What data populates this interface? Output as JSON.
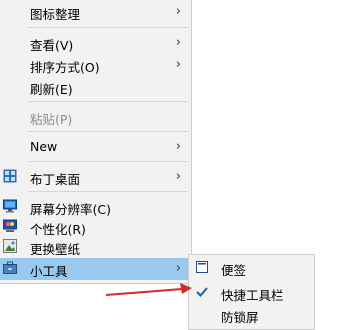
{
  "menu": {
    "items": [
      {
        "label": "图标整理",
        "has_submenu": true
      },
      {
        "label": "查看(V)",
        "has_submenu": true
      },
      {
        "label": "排序方式(O)",
        "has_submenu": true
      },
      {
        "label": "刷新(E)",
        "has_submenu": false
      },
      {
        "label": "粘贴(P)",
        "has_submenu": false,
        "disabled": true
      },
      {
        "label": "New",
        "has_submenu": true
      },
      {
        "label": "布丁桌面",
        "icon": "grid-app-icon",
        "has_submenu": true
      },
      {
        "label": "屏幕分辨率(C)",
        "icon": "monitor-icon",
        "has_submenu": false
      },
      {
        "label": "个性化(R)",
        "icon": "personalize-icon",
        "has_submenu": false
      },
      {
        "label": "更换壁纸",
        "icon": "wallpaper-icon",
        "has_submenu": false
      },
      {
        "label": "小工具",
        "icon": "toolbox-icon",
        "has_submenu": true,
        "highlighted": true
      }
    ],
    "arrow_glyph": "›"
  },
  "submenu": {
    "items": [
      {
        "label": "便签",
        "icon": "note-icon"
      },
      {
        "label": "快捷工具栏",
        "icon": "check-icon",
        "checked": true
      },
      {
        "label": "防锁屏",
        "icon": ""
      }
    ]
  },
  "colors": {
    "menu_bg": "#f2f2f2",
    "highlight": "#99c9ef",
    "separator": "#d5d5d5",
    "disabled_text": "#8c8c8c",
    "annotation_arrow": "#d9262b",
    "checkmark": "#1f5fa8"
  }
}
